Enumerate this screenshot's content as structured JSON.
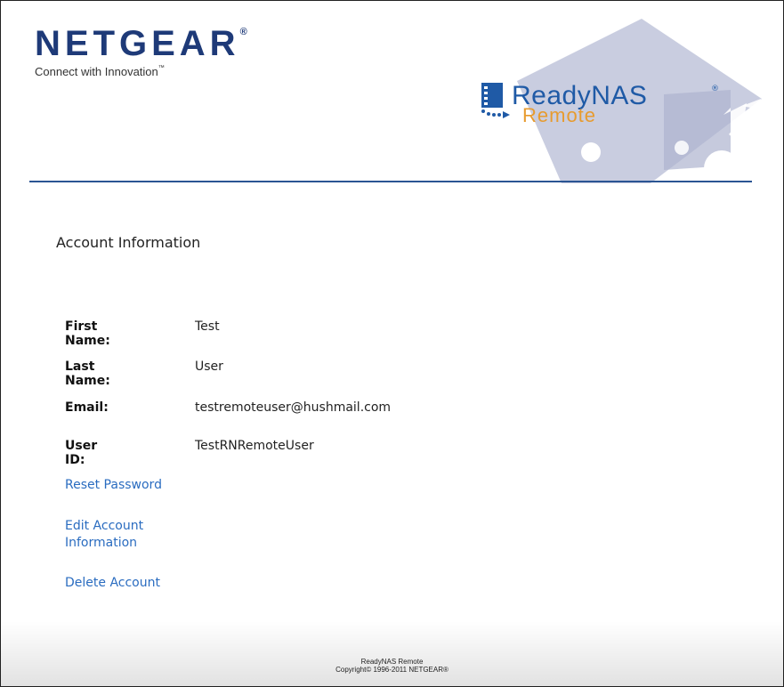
{
  "brand": {
    "name": "NETGEAR",
    "reg": "®",
    "tagline": "Connect with Innovation",
    "tm": "™"
  },
  "product": {
    "name": "ReadyNAS",
    "reg": "®",
    "sub": "Remote"
  },
  "page": {
    "title": "Account Information"
  },
  "account": {
    "fields": [
      {
        "label": "First Name:",
        "value": "Test"
      },
      {
        "label": "Last Name:",
        "value": "User"
      },
      {
        "label": "Email:",
        "value": "testremoteuser@hushmail.com"
      },
      {
        "label": "User ID:",
        "value": "TestRNRemoteUser"
      }
    ]
  },
  "links": {
    "reset_password": "Reset Password",
    "edit_account_line1": "Edit Account",
    "edit_account_line2": "Information",
    "delete_account": "Delete Account"
  },
  "footer": {
    "product": "ReadyNAS Remote",
    "copyright": "Copyright© 1996-2011 NETGEAR®"
  },
  "colors": {
    "brand_blue": "#1e3a78",
    "link_blue": "#2a6cc0",
    "accent_orange": "#e79b2f",
    "deco_gray": "#c9cde0"
  }
}
